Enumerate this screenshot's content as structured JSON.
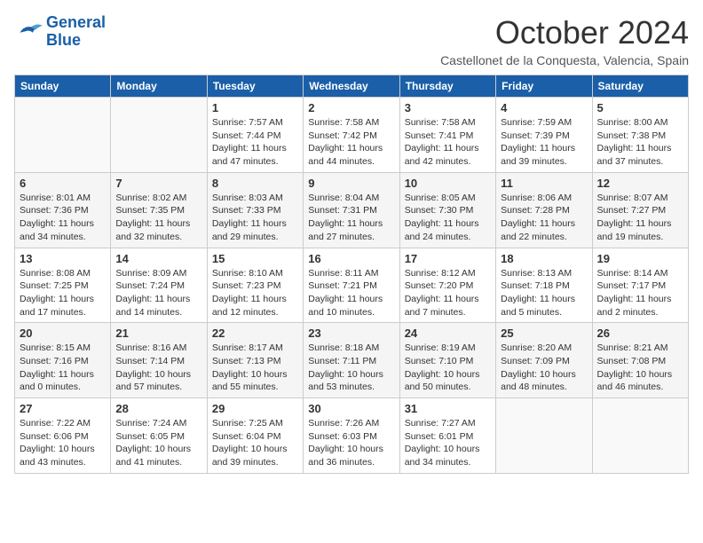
{
  "header": {
    "logo_line1": "General",
    "logo_line2": "Blue",
    "month": "October 2024",
    "location": "Castellonet de la Conquesta, Valencia, Spain"
  },
  "days_of_week": [
    "Sunday",
    "Monday",
    "Tuesday",
    "Wednesday",
    "Thursday",
    "Friday",
    "Saturday"
  ],
  "weeks": [
    [
      {
        "day": "",
        "info": ""
      },
      {
        "day": "",
        "info": ""
      },
      {
        "day": "1",
        "info": "Sunrise: 7:57 AM\nSunset: 7:44 PM\nDaylight: 11 hours and 47 minutes."
      },
      {
        "day": "2",
        "info": "Sunrise: 7:58 AM\nSunset: 7:42 PM\nDaylight: 11 hours and 44 minutes."
      },
      {
        "day": "3",
        "info": "Sunrise: 7:58 AM\nSunset: 7:41 PM\nDaylight: 11 hours and 42 minutes."
      },
      {
        "day": "4",
        "info": "Sunrise: 7:59 AM\nSunset: 7:39 PM\nDaylight: 11 hours and 39 minutes."
      },
      {
        "day": "5",
        "info": "Sunrise: 8:00 AM\nSunset: 7:38 PM\nDaylight: 11 hours and 37 minutes."
      }
    ],
    [
      {
        "day": "6",
        "info": "Sunrise: 8:01 AM\nSunset: 7:36 PM\nDaylight: 11 hours and 34 minutes."
      },
      {
        "day": "7",
        "info": "Sunrise: 8:02 AM\nSunset: 7:35 PM\nDaylight: 11 hours and 32 minutes."
      },
      {
        "day": "8",
        "info": "Sunrise: 8:03 AM\nSunset: 7:33 PM\nDaylight: 11 hours and 29 minutes."
      },
      {
        "day": "9",
        "info": "Sunrise: 8:04 AM\nSunset: 7:31 PM\nDaylight: 11 hours and 27 minutes."
      },
      {
        "day": "10",
        "info": "Sunrise: 8:05 AM\nSunset: 7:30 PM\nDaylight: 11 hours and 24 minutes."
      },
      {
        "day": "11",
        "info": "Sunrise: 8:06 AM\nSunset: 7:28 PM\nDaylight: 11 hours and 22 minutes."
      },
      {
        "day": "12",
        "info": "Sunrise: 8:07 AM\nSunset: 7:27 PM\nDaylight: 11 hours and 19 minutes."
      }
    ],
    [
      {
        "day": "13",
        "info": "Sunrise: 8:08 AM\nSunset: 7:25 PM\nDaylight: 11 hours and 17 minutes."
      },
      {
        "day": "14",
        "info": "Sunrise: 8:09 AM\nSunset: 7:24 PM\nDaylight: 11 hours and 14 minutes."
      },
      {
        "day": "15",
        "info": "Sunrise: 8:10 AM\nSunset: 7:23 PM\nDaylight: 11 hours and 12 minutes."
      },
      {
        "day": "16",
        "info": "Sunrise: 8:11 AM\nSunset: 7:21 PM\nDaylight: 11 hours and 10 minutes."
      },
      {
        "day": "17",
        "info": "Sunrise: 8:12 AM\nSunset: 7:20 PM\nDaylight: 11 hours and 7 minutes."
      },
      {
        "day": "18",
        "info": "Sunrise: 8:13 AM\nSunset: 7:18 PM\nDaylight: 11 hours and 5 minutes."
      },
      {
        "day": "19",
        "info": "Sunrise: 8:14 AM\nSunset: 7:17 PM\nDaylight: 11 hours and 2 minutes."
      }
    ],
    [
      {
        "day": "20",
        "info": "Sunrise: 8:15 AM\nSunset: 7:16 PM\nDaylight: 11 hours and 0 minutes."
      },
      {
        "day": "21",
        "info": "Sunrise: 8:16 AM\nSunset: 7:14 PM\nDaylight: 10 hours and 57 minutes."
      },
      {
        "day": "22",
        "info": "Sunrise: 8:17 AM\nSunset: 7:13 PM\nDaylight: 10 hours and 55 minutes."
      },
      {
        "day": "23",
        "info": "Sunrise: 8:18 AM\nSunset: 7:11 PM\nDaylight: 10 hours and 53 minutes."
      },
      {
        "day": "24",
        "info": "Sunrise: 8:19 AM\nSunset: 7:10 PM\nDaylight: 10 hours and 50 minutes."
      },
      {
        "day": "25",
        "info": "Sunrise: 8:20 AM\nSunset: 7:09 PM\nDaylight: 10 hours and 48 minutes."
      },
      {
        "day": "26",
        "info": "Sunrise: 8:21 AM\nSunset: 7:08 PM\nDaylight: 10 hours and 46 minutes."
      }
    ],
    [
      {
        "day": "27",
        "info": "Sunrise: 7:22 AM\nSunset: 6:06 PM\nDaylight: 10 hours and 43 minutes."
      },
      {
        "day": "28",
        "info": "Sunrise: 7:24 AM\nSunset: 6:05 PM\nDaylight: 10 hours and 41 minutes."
      },
      {
        "day": "29",
        "info": "Sunrise: 7:25 AM\nSunset: 6:04 PM\nDaylight: 10 hours and 39 minutes."
      },
      {
        "day": "30",
        "info": "Sunrise: 7:26 AM\nSunset: 6:03 PM\nDaylight: 10 hours and 36 minutes."
      },
      {
        "day": "31",
        "info": "Sunrise: 7:27 AM\nSunset: 6:01 PM\nDaylight: 10 hours and 34 minutes."
      },
      {
        "day": "",
        "info": ""
      },
      {
        "day": "",
        "info": ""
      }
    ]
  ]
}
